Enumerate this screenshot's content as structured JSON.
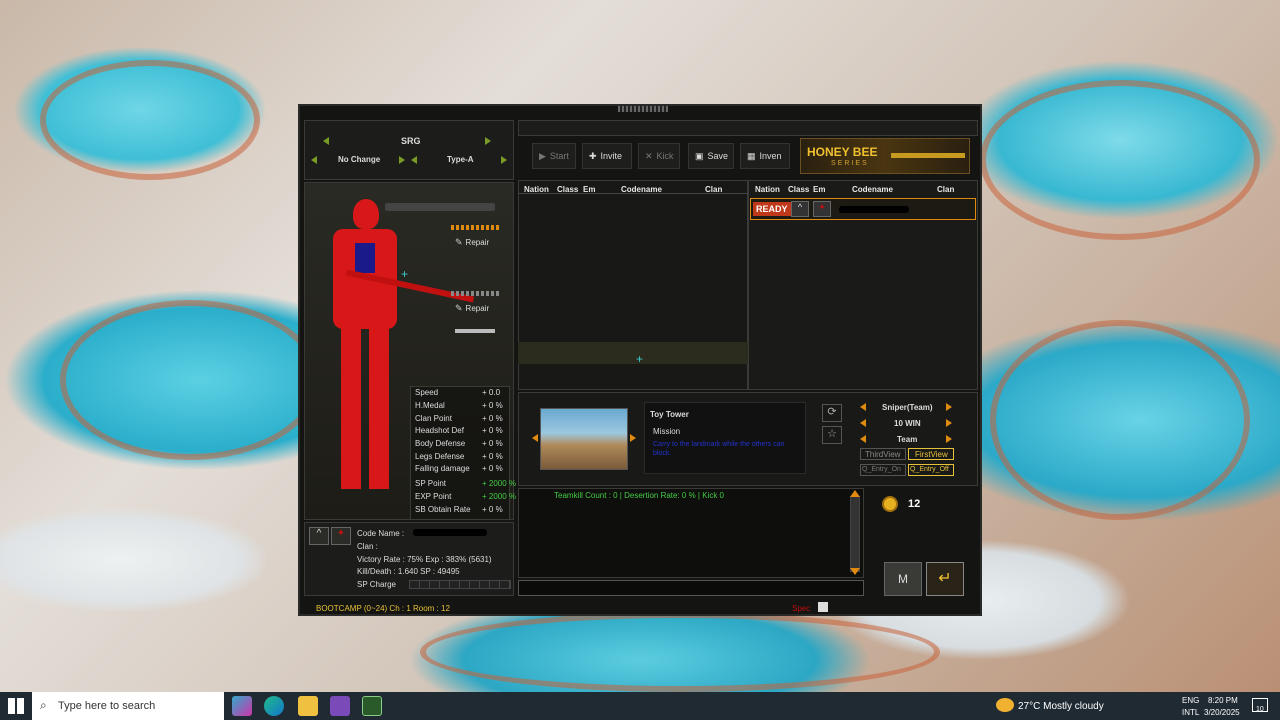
{
  "weapon_header": {
    "title": "SRG",
    "left_option": "No Change",
    "right_option": "Type-A"
  },
  "repair_labels": [
    "Repair",
    "Repair"
  ],
  "stats": [
    {
      "label": "Speed",
      "value": "+ 0.0"
    },
    {
      "label": "H.Medal",
      "value": "+ 0 %"
    },
    {
      "label": "Clan Point",
      "value": "+ 0 %"
    },
    {
      "label": "Headshot Def",
      "value": "+ 0 %"
    },
    {
      "label": "Body Defense",
      "value": "+ 0 %"
    },
    {
      "label": "Legs Defense",
      "value": "+ 0 %"
    },
    {
      "label": "Falling damage",
      "value": "+ 0 %"
    },
    {
      "label": "SP Point",
      "value": "+ 2000 %"
    },
    {
      "label": "EXP Point",
      "value": "+ 2000 %"
    },
    {
      "label": "SB Obtain Rate",
      "value": "+ 0 %"
    }
  ],
  "profile": {
    "code_name_label": "Code Name :",
    "clan_label": "Clan :",
    "victory_exp": "Victory Rate : 75%  Exp : 383% (5631)",
    "kill_sp": "Kill/Death : 1.640   SP : 49495",
    "sp_charge_label": "SP Charge"
  },
  "status_bar": {
    "channel": "BOOTCAMP (0~24)  Ch : 1   Room : 12",
    "spec": "Spec"
  },
  "toolbar": {
    "start": "Start",
    "invite": "Invite",
    "kick": "Kick",
    "save": "Save",
    "inven": "Inven"
  },
  "banner": {
    "line1": "HONEY BEE",
    "line2": "SERIES"
  },
  "table_headers": [
    "Nation",
    "Class",
    "Em",
    "Codename",
    "Clan"
  ],
  "ready_badge": "READY",
  "map": {
    "name": "Toy Tower",
    "mode": "Mission",
    "description": "Carry to the landmark while the others can block."
  },
  "settings": {
    "mode": "Sniper(Team)",
    "win": "10 WIN",
    "team": "Team",
    "third_view": "ThirdView",
    "first_view": "FirstView",
    "entry_on": "Q_Entry_On",
    "entry_off": "Q_Entry_Off"
  },
  "chat": {
    "line": "Teamkill Count : 0 | Desertion Rate: 0 % | Kick 0"
  },
  "coins": {
    "count": "12"
  },
  "taskbar": {
    "search_placeholder": "Type here to search",
    "weather": "27°C  Mostly cloudy",
    "lang1": "ENG",
    "lang2": "INTL",
    "time": "8:20 PM",
    "date": "3/20/2025",
    "notif": "10"
  },
  "colors": {
    "accent_green": "#7a9a26",
    "accent_orange": "#e08a10",
    "gold": "#e6c23a"
  }
}
